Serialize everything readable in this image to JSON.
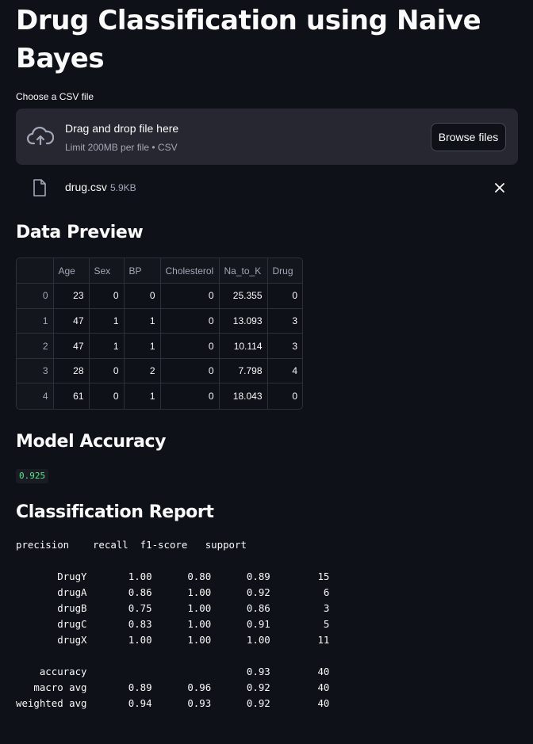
{
  "page": {
    "title": "Drug Classification using Naive Bayes"
  },
  "uploader": {
    "label": "Choose a CSV file",
    "drop_text": "Drag and drop file here",
    "limit_text": "Limit 200MB per file • CSV",
    "browse_label": "Browse files",
    "file": {
      "name": "drug.csv",
      "size": "5.9KB"
    }
  },
  "preview": {
    "heading": "Data Preview",
    "columns": [
      "",
      "Age",
      "Sex",
      "BP",
      "Cholesterol",
      "Na_to_K",
      "Drug"
    ],
    "rows": [
      [
        "0",
        "23",
        "0",
        "0",
        "0",
        "25.355",
        "0"
      ],
      [
        "1",
        "47",
        "1",
        "1",
        "0",
        "13.093",
        "3"
      ],
      [
        "2",
        "47",
        "1",
        "1",
        "0",
        "10.114",
        "3"
      ],
      [
        "3",
        "28",
        "0",
        "2",
        "0",
        "7.798",
        "4"
      ],
      [
        "4",
        "61",
        "0",
        "1",
        "0",
        "18.043",
        "0"
      ]
    ]
  },
  "accuracy": {
    "heading": "Model Accuracy",
    "value": "0.925"
  },
  "report": {
    "heading": "Classification Report",
    "text": "precision    recall  f1-score   support\n\n       DrugY       1.00      0.80      0.89        15\n       drugA       0.86      1.00      0.92         6\n       drugB       0.75      1.00      0.86         3\n       drugC       0.83      1.00      0.91         5\n       drugX       1.00      1.00      1.00        11\n\n    accuracy                           0.93        40\n   macro avg       0.89      0.96      0.92        40\nweighted avg       0.94      0.93      0.92        40"
  },
  "colors": {
    "background": "#0e1117",
    "surface": "#262730",
    "accuracy_text": "#5ce488"
  },
  "icons": {
    "upload": "cloud-upload-icon",
    "file": "file-icon",
    "remove": "close-icon"
  }
}
